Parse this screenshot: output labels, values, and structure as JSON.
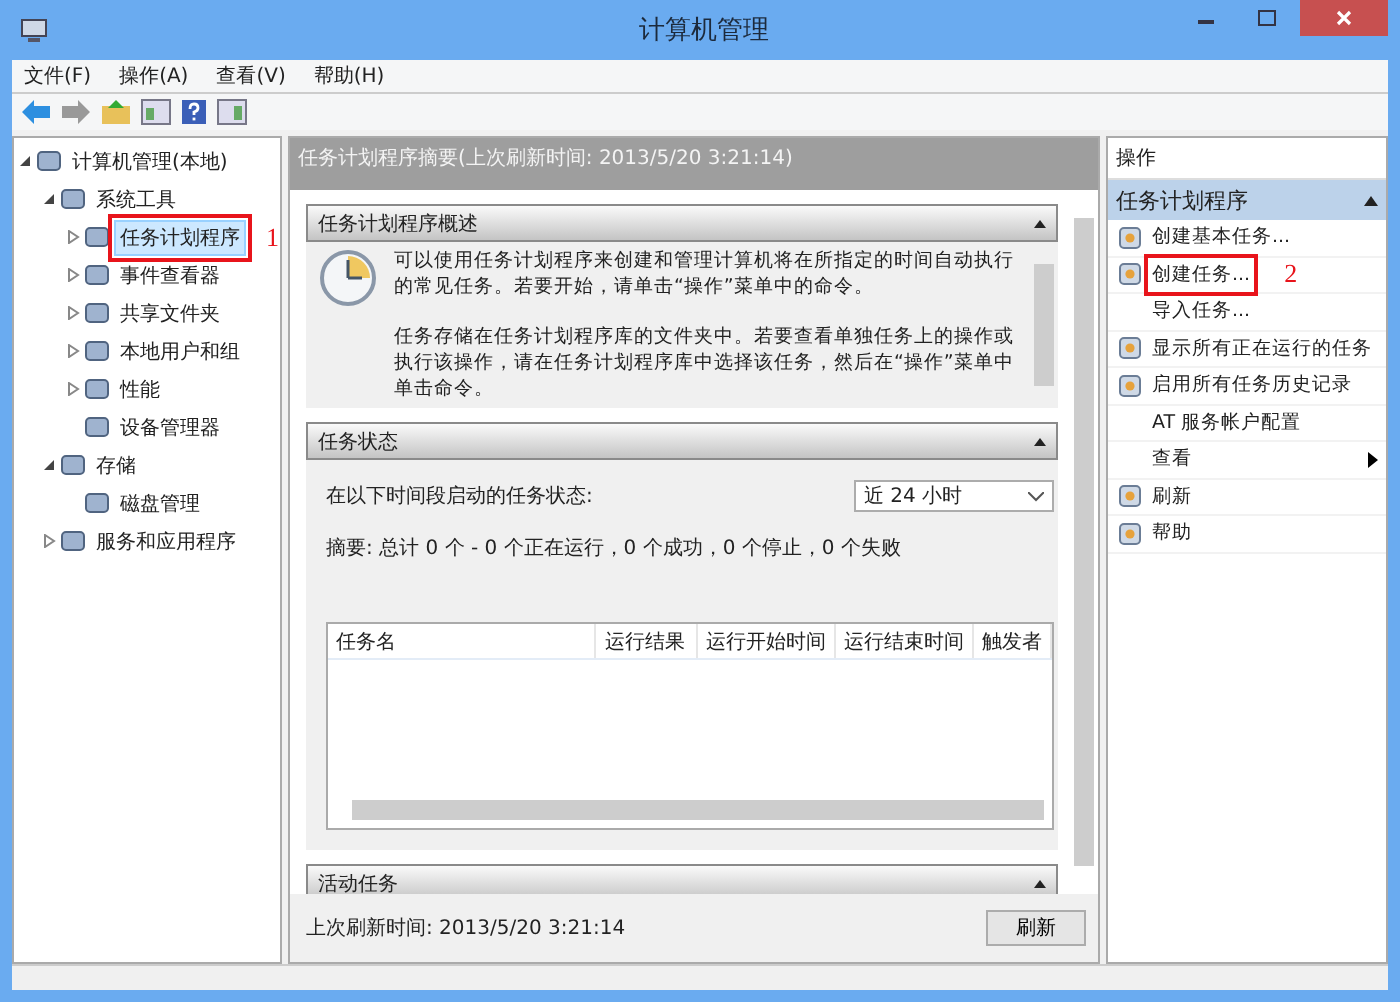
{
  "window": {
    "title": "计算机管理"
  },
  "menu": [
    "文件(F)",
    "操作(A)",
    "查看(V)",
    "帮助(H)"
  ],
  "tree": [
    {
      "label": "计算机管理(本地)",
      "expanded": true,
      "selected": false,
      "children": [
        {
          "label": "系统工具",
          "expanded": true,
          "selected": false,
          "children": [
            {
              "label": "任务计划程序",
              "expanded": false,
              "selected": true,
              "annotation": "1"
            },
            {
              "label": "事件查看器",
              "expanded": false,
              "selected": false
            },
            {
              "label": "共享文件夹",
              "expanded": false,
              "selected": false
            },
            {
              "label": "本地用户和组",
              "expanded": false,
              "selected": false
            },
            {
              "label": "性能",
              "expanded": false,
              "selected": false
            },
            {
              "label": "设备管理器",
              "selected": false
            }
          ]
        },
        {
          "label": "存储",
          "expanded": true,
          "selected": false,
          "children": [
            {
              "label": "磁盘管理",
              "selected": false
            }
          ]
        },
        {
          "label": "服务和应用程序",
          "expanded": false,
          "selected": false
        }
      ]
    }
  ],
  "summary": {
    "title": "任务计划程序摘要(上次刷新时间: 2013/5/20 3:21:14)",
    "overview": {
      "title": "任务计划程序概述",
      "paragraphs": [
        "可以使用任务计划程序来创建和管理计算机将在所指定的时间自动执行的常见任务。若要开始，请单击“操作”菜单中的命令。",
        "任务存储在任务计划程序库的文件夹中。若要查看单独任务上的操作或执行该操作，请在任务计划程序库中选择该任务，然后在“操作”菜单中单击命令。"
      ]
    },
    "status": {
      "title": "任务状态",
      "period_label": "在以下时间段启动的任务状态:",
      "period": "近 24 小时",
      "summary": "摘要: 总计 0 个 - 0 个正在运行，0 个成功，0 个停止，0 个失败",
      "columns": [
        "任务名",
        "运行结果",
        "运行开始时间",
        "运行结束时间",
        "触发者"
      ]
    },
    "active": {
      "title": "活动任务"
    },
    "last_refresh": "上次刷新时间: 2013/5/20 3:21:14",
    "refresh_button": "刷新"
  },
  "actions": {
    "title": "操作",
    "section": "任务计划程序",
    "items": [
      {
        "label": "创建基本任务...",
        "kind": "icon"
      },
      {
        "label": "创建任务...",
        "kind": "icon",
        "annotation": "2"
      },
      {
        "label": "导入任务...",
        "kind": "plain"
      },
      {
        "label": "显示所有正在运行的任务",
        "kind": "icon"
      },
      {
        "label": "启用所有任务历史记录",
        "kind": "icon"
      },
      {
        "label": "AT 服务帐户配置",
        "kind": "plain"
      },
      {
        "label": "查看",
        "kind": "submenu"
      },
      {
        "label": "刷新",
        "kind": "icon"
      },
      {
        "label": "帮助",
        "kind": "icon"
      }
    ]
  }
}
